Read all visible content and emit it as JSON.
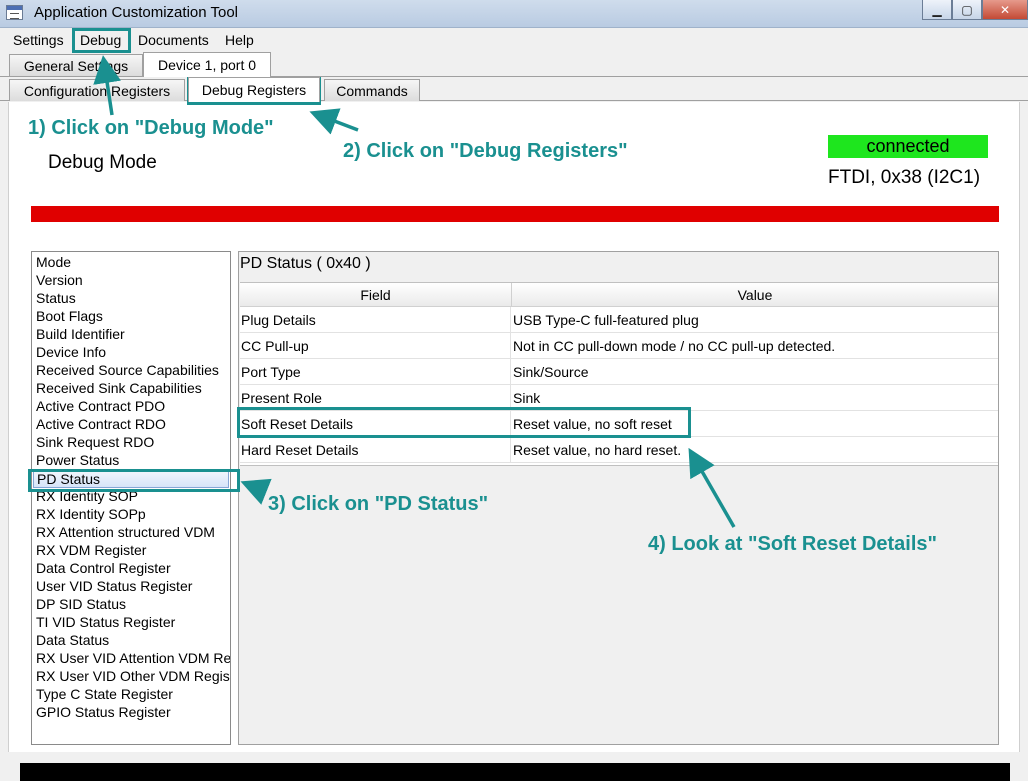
{
  "window": {
    "title": "Application Customization Tool",
    "minimize_symbol": "▁",
    "maximize_symbol": "▢",
    "close_symbol": "✕"
  },
  "menu": {
    "items": [
      "Settings",
      "Debug",
      "Documents",
      "Help"
    ]
  },
  "tabs_top": [
    "General Settings",
    "Device 1, port 0"
  ],
  "tabs_sub": [
    "Configuration Registers",
    "Debug Registers",
    "Commands"
  ],
  "header": {
    "mode_label": "Debug Mode",
    "connection_status": "connected",
    "connection_info": "FTDI, 0x38 (I2C1)"
  },
  "register_list": {
    "items": [
      "Mode",
      "Version",
      "Status",
      "Boot Flags",
      "Build Identifier",
      "Device Info",
      "Received Source Capabilities",
      "Received Sink Capabilities",
      "Active Contract PDO",
      "Active Contract RDO",
      "Sink Request RDO",
      "Power Status",
      "PD Status",
      "RX Identity SOP",
      "RX Identity SOPp",
      "RX Attention structured VDM",
      "RX VDM Register",
      "Data Control Register",
      "User VID Status Register",
      "DP SID Status",
      "TI VID Status Register",
      "Data Status",
      "RX User VID Attention VDM Register",
      "RX User VID Other VDM Register",
      "Type C State Register",
      "GPIO Status Register"
    ],
    "selected": "PD Status"
  },
  "detail": {
    "title": "PD Status  ( 0x40 )",
    "columns": [
      "Field",
      "Value"
    ],
    "rows": [
      {
        "field": "Plug Details",
        "value": "USB Type-C full-featured plug"
      },
      {
        "field": "CC Pull-up",
        "value": "Not in CC pull-down mode / no CC pull-up detected."
      },
      {
        "field": "Port Type",
        "value": "Sink/Source"
      },
      {
        "field": "Present Role",
        "value": "Sink"
      },
      {
        "field": "Soft Reset Details",
        "value": "Reset value, no soft reset"
      },
      {
        "field": "Hard Reset Details",
        "value": "Reset value, no hard reset."
      }
    ]
  },
  "annotations": {
    "step1": "1) Click on \"Debug Mode\"",
    "step2": "2) Click on \"Debug Registers\"",
    "step3": "3) Click on \"PD Status\"",
    "step4": "4) Look at \"Soft Reset Details\"",
    "color": "#1a9090"
  },
  "colors": {
    "connected": "#1ee61e",
    "alert_bar": "#e00000"
  }
}
